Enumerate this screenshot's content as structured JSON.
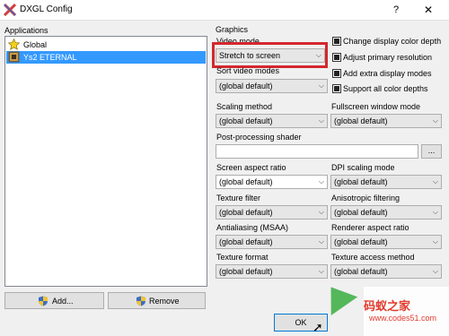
{
  "window": {
    "title": "DXGL Config",
    "help": "?",
    "close": "✕"
  },
  "applications": {
    "title": "Applications",
    "items": [
      {
        "label": "Global",
        "icon": "star-icon",
        "selected": false
      },
      {
        "label": "Ys2 ETERNAL",
        "icon": "game-icon",
        "selected": true
      }
    ],
    "add_label": "Add...",
    "remove_label": "Remove"
  },
  "graphics": {
    "title": "Graphics",
    "video_mode": {
      "label": "Video mode",
      "value": "Stretch to screen"
    },
    "sort_video_modes": {
      "label": "Sort video modes",
      "value": "(global default)"
    },
    "scaling_method": {
      "label": "Scaling method",
      "value": "(global default)"
    },
    "fullscreen_window_mode": {
      "label": "Fullscreen window mode",
      "value": "(global default)"
    },
    "post_processing_shader": {
      "label": "Post-processing shader",
      "value": "",
      "browse": "..."
    },
    "screen_aspect_ratio": {
      "label": "Screen aspect ratio",
      "value": "(global default)"
    },
    "dpi_scaling_mode": {
      "label": "DPI scaling mode",
      "value": "(global default)"
    },
    "texture_filter": {
      "label": "Texture filter",
      "value": "(global default)"
    },
    "anisotropic_filtering": {
      "label": "Anisotropic filtering",
      "value": "(global default)"
    },
    "antialiasing": {
      "label": "Antialiasing (MSAA)",
      "value": "(global default)"
    },
    "renderer_aspect_ratio": {
      "label": "Renderer aspect ratio",
      "value": "(global default)"
    },
    "texture_format": {
      "label": "Texture format",
      "value": "(global default)"
    },
    "texture_access_method": {
      "label": "Texture access method",
      "value": "(global default)"
    },
    "checkboxes": [
      {
        "label": "Change display color depth",
        "checked": true
      },
      {
        "label": "Adjust primary resolution",
        "checked": true
      },
      {
        "label": "Add extra display modes",
        "checked": true
      },
      {
        "label": "Support all color depths",
        "checked": true
      }
    ]
  },
  "footer": {
    "ok_label": "OK"
  },
  "watermark": {
    "main": "码蚁之家",
    "sub": "www.codes51.com"
  },
  "colors": {
    "selection": "#3399ff",
    "highlight": "#d3272e",
    "watermark": "#e23b2d"
  }
}
